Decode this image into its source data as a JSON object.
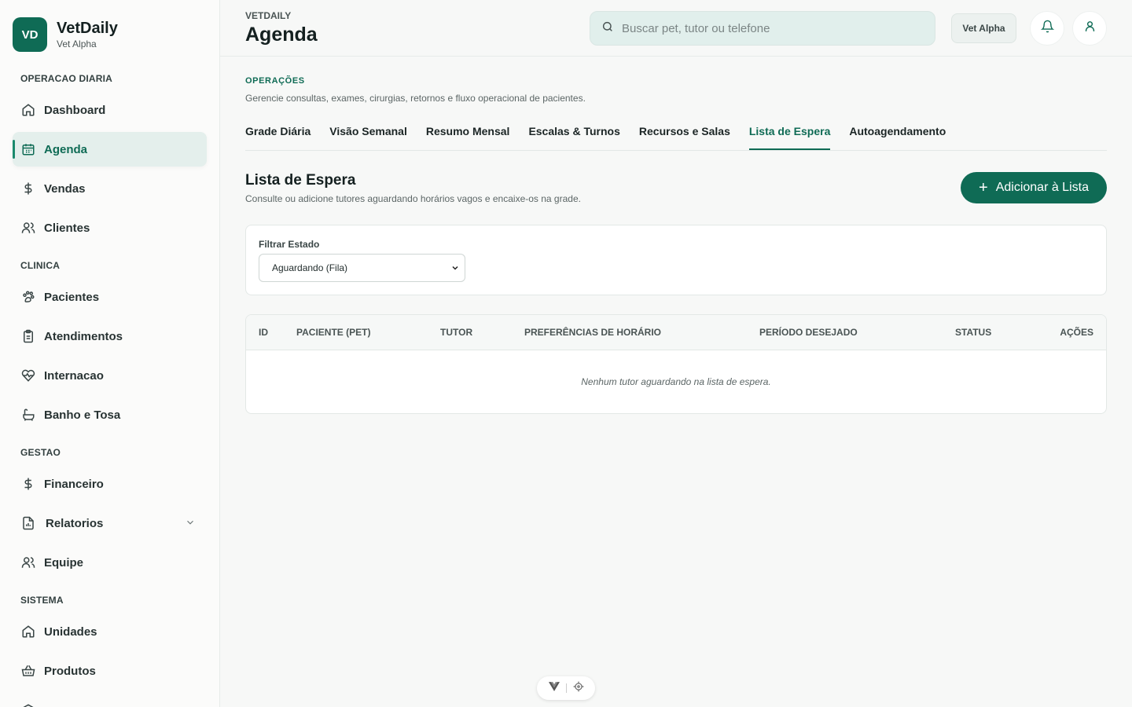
{
  "brand": {
    "initials": "VD",
    "name": "VetDaily",
    "subtitle": "Vet Alpha"
  },
  "sidebar": {
    "sections": [
      {
        "title": "OPERACAO DIARIA"
      },
      {
        "title": "CLINICA"
      },
      {
        "title": "GESTAO"
      },
      {
        "title": "SISTEMA"
      }
    ],
    "items": [
      {
        "label": "Dashboard",
        "icon": "home-icon"
      },
      {
        "label": "Agenda",
        "icon": "calendar-icon",
        "active": true
      },
      {
        "label": "Vendas",
        "icon": "dollar-icon"
      },
      {
        "label": "Clientes",
        "icon": "users-icon"
      },
      {
        "label": "Pacientes",
        "icon": "paw-icon"
      },
      {
        "label": "Atendimentos",
        "icon": "clipboard-icon"
      },
      {
        "label": "Internacao",
        "icon": "heart-pulse-icon"
      },
      {
        "label": "Banho e Tosa",
        "icon": "bath-icon"
      },
      {
        "label": "Financeiro",
        "icon": "dollar-icon"
      },
      {
        "label": "Relatorios",
        "icon": "report-icon",
        "expandable": true
      },
      {
        "label": "Equipe",
        "icon": "users-icon"
      },
      {
        "label": "Unidades",
        "icon": "home-icon"
      },
      {
        "label": "Produtos",
        "icon": "basket-icon"
      }
    ]
  },
  "header": {
    "breadcrumb": "VETDAILY",
    "title": "Agenda",
    "search_placeholder": "Buscar pet, tutor ou telefone",
    "org_chip": "Vet Alpha"
  },
  "operations": {
    "label": "OPERAÇÕES",
    "description": "Gerencie consultas, exames, cirurgias, retornos e fluxo operacional de pacientes.",
    "tabs": [
      {
        "label": "Grade Diária"
      },
      {
        "label": "Visão Semanal"
      },
      {
        "label": "Resumo Mensal"
      },
      {
        "label": "Escalas & Turnos"
      },
      {
        "label": "Recursos e Salas"
      },
      {
        "label": "Lista de Espera",
        "active": true
      },
      {
        "label": "Autoagendamento"
      }
    ]
  },
  "waitlist": {
    "title": "Lista de Espera",
    "subtitle": "Consulte ou adicione tutores aguardando horários vagos e encaixe-os na grade.",
    "add_button": "Adicionar à Lista",
    "filter_label": "Filtrar Estado",
    "filter_value": "Aguardando (Fila)",
    "columns": [
      "ID",
      "PACIENTE (PET)",
      "TUTOR",
      "PREFERÊNCIAS DE HORÁRIO",
      "PERÍODO DESEJADO",
      "STATUS",
      "AÇÕES"
    ],
    "empty_message": "Nenhum tutor aguardando na lista de espera."
  },
  "colors": {
    "primary": "#0f6b55",
    "active_bg": "#e4efec",
    "search_bg": "#e1efec"
  }
}
